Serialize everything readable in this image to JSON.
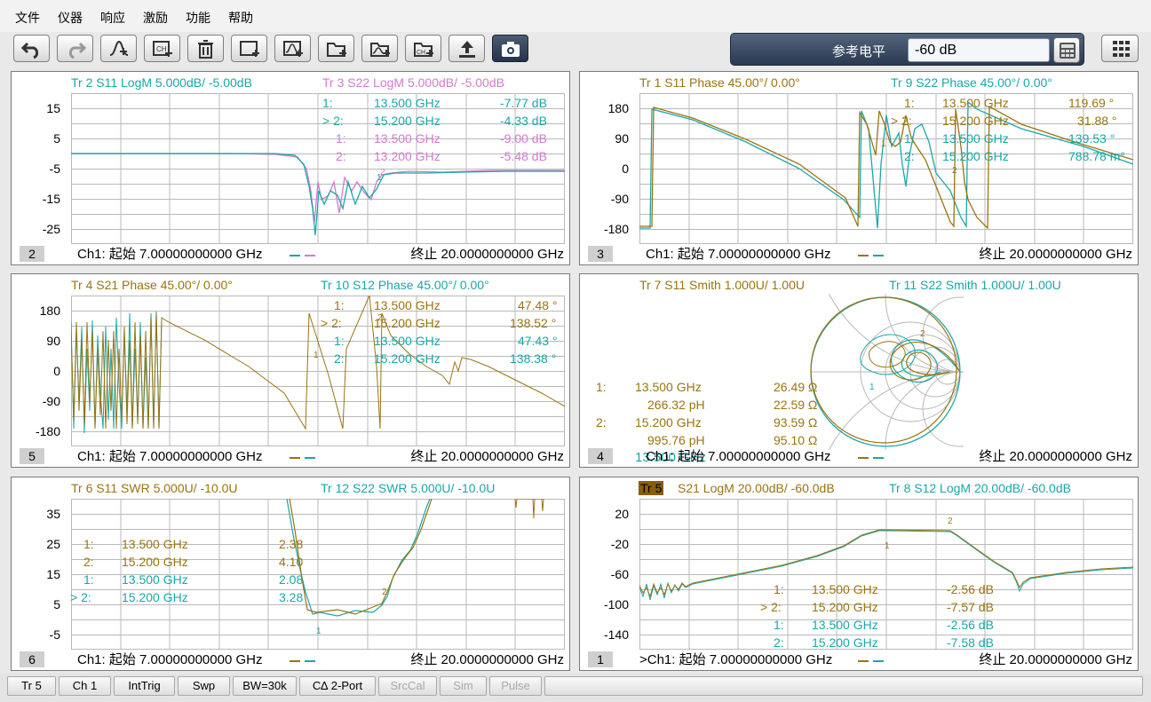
{
  "menu": [
    "文件",
    "仪器",
    "响应",
    "激励",
    "功能",
    "帮助"
  ],
  "toolbar": {
    "buttons": [
      "undo-icon",
      "redo-icon",
      "marker-add-icon",
      "channel-add-icon",
      "delete-icon",
      "window-add-icon",
      "trace-window-add-icon",
      "folder-add-icon",
      "folder-trace-add-icon",
      "folder-channel-add-icon",
      "upload-icon",
      "camera-icon"
    ],
    "ref_label": "参考电平",
    "ref_value": "-60 dB"
  },
  "colors": {
    "teal": "#1aa7a8",
    "gold": "#9a7410",
    "magenta": "#d27ad0",
    "grid": "#b9b9b9"
  },
  "panels": [
    {
      "id": "2",
      "titles": [
        {
          "text": "Tr  2   S11 LogM 5.000dB/  -5.00dB",
          "color": "#1aa7a8"
        },
        {
          "text": "Tr  3   S22 LogM 5.000dB/  -5.00dB",
          "color": "#d27ad0"
        }
      ],
      "yticks": [
        "15",
        "5",
        "-5",
        "-15",
        "-25"
      ],
      "markers": [
        {
          "prefix": "1:",
          "freq": "13.500  GHz",
          "value": "-7.77 dB",
          "color": "#1aa7a8"
        },
        {
          "prefix": "> 2:",
          "freq": "15.200  GHz",
          "value": "-4.33 dB",
          "color": "#1aa7a8"
        },
        {
          "prefix": "1:",
          "freq": "13.500  GHz",
          "value": "-9.00 dB",
          "color": "#d27ad0"
        },
        {
          "prefix": "2:",
          "freq": "13.200  GHz",
          "value": "-5.48 dB",
          "color": "#d27ad0"
        }
      ],
      "start": "Ch1:  起始    7.00000000000 GHz",
      "stop": "终止   20.0000000000 GHz"
    },
    {
      "id": "3",
      "titles": [
        {
          "text": "Tr  1   S11 Phase 45.00°/  0.00°",
          "color": "#9a7410"
        },
        {
          "text": "Tr  9   S22 Phase 45.00°/  0.00°",
          "color": "#1aa7a8"
        }
      ],
      "yticks": [
        "180",
        "90",
        "0",
        "-90",
        "-180"
      ],
      "markers": [
        {
          "prefix": "1:",
          "freq": "13.500  GHz",
          "value": "119.69 °",
          "color": "#9a7410"
        },
        {
          "prefix": "> 2:",
          "freq": "15.200  GHz",
          "value": "31.88 °",
          "color": "#9a7410"
        },
        {
          "prefix": "1:",
          "freq": "13.500  GHz",
          "value": "139.53 °",
          "color": "#1aa7a8"
        },
        {
          "prefix": "2:",
          "freq": "15.200  GHz",
          "value": "788.78 m°",
          "color": "#1aa7a8"
        }
      ],
      "start": "Ch1:  起始    7.00000000000 GHz",
      "stop": "终止   20.0000000000 GHz"
    },
    {
      "id": "5",
      "titles": [
        {
          "text": "Tr  4   S21 Phase 45.00°/  0.00°",
          "color": "#9a7410"
        },
        {
          "text": "Tr 10  S12 Phase 45.00°/  0.00°",
          "color": "#1aa7a8"
        }
      ],
      "yticks": [
        "180",
        "90",
        "0",
        "-90",
        "-180"
      ],
      "markers": [
        {
          "prefix": "1:",
          "freq": "13.500  GHz",
          "value": "47.48 °",
          "color": "#9a7410"
        },
        {
          "prefix": "> 2:",
          "freq": "15.200  GHz",
          "value": "138.52 °",
          "color": "#9a7410"
        },
        {
          "prefix": "1:",
          "freq": "13.500  GHz",
          "value": "47.43 °",
          "color": "#1aa7a8"
        },
        {
          "prefix": "2:",
          "freq": "15.200  GHz",
          "value": "138.38 °",
          "color": "#1aa7a8"
        }
      ],
      "start": "Ch1:  起始    7.00000000000 GHz",
      "stop": "终止   20.0000000000 GHz"
    },
    {
      "id": "4",
      "titles": [
        {
          "text": "Tr  7   S11 Smith 1.000U/  1.00U",
          "color": "#9a7410"
        },
        {
          "text": "Tr 11  S22 Smith 1.000U/  1.00U",
          "color": "#1aa7a8"
        }
      ],
      "smith_markers": [
        {
          "prefix": "1:",
          "freq": "13.500  GHz",
          "value": "26.49 Ω"
        },
        {
          "prefix": "",
          "freq": "266.32 pH",
          "value": "22.59 Ω"
        },
        {
          "prefix": "2:",
          "freq": "15.200  GHz",
          "value": "93.59 Ω"
        },
        {
          "prefix": "",
          "freq": "995.76 pH",
          "value": "95.10 Ω"
        }
      ],
      "overlap": "13.500  GHz",
      "start": "Ch1:  起始    7.00000000000 GHz",
      "stop": "终止   20.0000000000 GHz"
    },
    {
      "id": "6",
      "titles": [
        {
          "text": "Tr  6   S11 SWR 5.000U/  -10.0U",
          "color": "#9a7410"
        },
        {
          "text": "Tr 12  S22 SWR 5.000U/  -10.0U",
          "color": "#1aa7a8"
        }
      ],
      "yticks": [
        "35",
        "25",
        "15",
        "5",
        "-5"
      ],
      "markers": [
        {
          "prefix": "1:",
          "freq": "13.500  GHz",
          "value": "2.38",
          "color": "#9a7410"
        },
        {
          "prefix": "2:",
          "freq": "15.200  GHz",
          "value": "4.10",
          "color": "#9a7410"
        },
        {
          "prefix": "1:",
          "freq": "13.500  GHz",
          "value": "2.08",
          "color": "#1aa7a8"
        },
        {
          "prefix": "> 2:",
          "freq": "15.200  GHz",
          "value": "3.28",
          "color": "#1aa7a8"
        }
      ],
      "start": "Ch1:  起始    7.00000000000 GHz",
      "stop": "终止   20.0000000000 GHz"
    },
    {
      "id": "1",
      "titles": [
        {
          "text": "Tr  5",
          "color": "#000000",
          "selected": true
        },
        {
          "text": "S21 LogM 20.00dB/  -60.0dB",
          "color": "#9a7410"
        },
        {
          "text": "Tr  8   S12 LogM 20.00dB/  -60.0dB",
          "color": "#1aa7a8"
        }
      ],
      "yticks": [
        "20",
        "-20",
        "-60",
        "-100",
        "-140"
      ],
      "markers": [
        {
          "prefix": "1:",
          "freq": "13.500  GHz",
          "value": "-2.56 dB",
          "color": "#9a7410"
        },
        {
          "prefix": "> 2:",
          "freq": "15.200  GHz",
          "value": "-7.57 dB",
          "color": "#9a7410"
        },
        {
          "prefix": "1:",
          "freq": "13.500  GHz",
          "value": "-2.56 dB",
          "color": "#1aa7a8"
        },
        {
          "prefix": "2:",
          "freq": "15.200  GHz",
          "value": "-7.58 dB",
          "color": "#1aa7a8"
        }
      ],
      "start": ">Ch1:  起始    7.00000000000 GHz",
      "stop": "终止   20.0000000000 GHz"
    }
  ],
  "statusbar": [
    {
      "label": "Tr 5",
      "enabled": true
    },
    {
      "label": "Ch 1",
      "enabled": true
    },
    {
      "label": "IntTrig",
      "enabled": true
    },
    {
      "label": "Swp",
      "enabled": true
    },
    {
      "label": "BW=30k",
      "enabled": true
    },
    {
      "label": "C∆ 2-Port",
      "enabled": true
    },
    {
      "label": "SrcCal",
      "enabled": false
    },
    {
      "label": "Sim",
      "enabled": false
    },
    {
      "label": "Pulse",
      "enabled": false
    }
  ]
}
